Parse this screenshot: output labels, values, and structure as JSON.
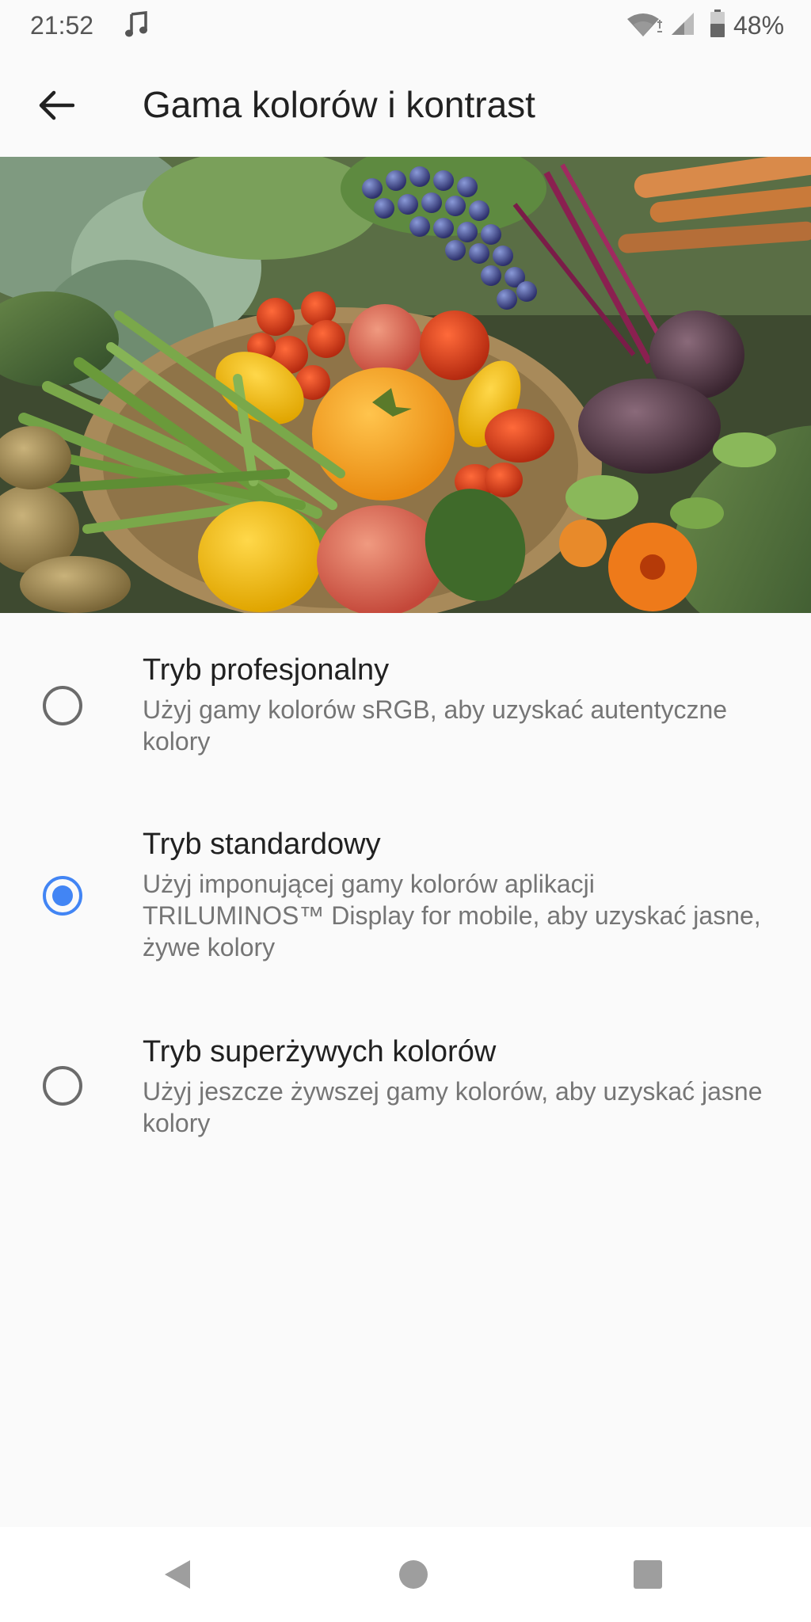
{
  "status_bar": {
    "time": "21:52",
    "battery": "48%",
    "icons": [
      "music-note-icon",
      "wifi-icon",
      "cell-signal-icon",
      "battery-icon"
    ]
  },
  "app_bar": {
    "title": "Gama kolorów i kontrast",
    "back_icon": "arrow-back-icon"
  },
  "options": [
    {
      "title": "Tryb profesjonalny",
      "description": "Użyj gamy kolorów sRGB, aby uzyskać autentyczne kolory",
      "selected": false
    },
    {
      "title": "Tryb standardowy",
      "description": "Użyj imponującej gamy kolorów aplikacji TRILUMINOS™ Display for mobile, aby uzyskać jasne, żywe kolory",
      "selected": true
    },
    {
      "title": "Tryb superżywych kolorów",
      "description": "Użyj jeszcze żywszej gamy kolorów, aby uzyskać jasne kolory",
      "selected": false
    }
  ],
  "colors": {
    "accent": "#4285f4",
    "background": "#fafafa",
    "primary_text": "#212121",
    "secondary_text": "#757575"
  },
  "nav_bar": {
    "icons": [
      "back-triangle-icon",
      "home-circle-icon",
      "recents-square-icon"
    ]
  }
}
